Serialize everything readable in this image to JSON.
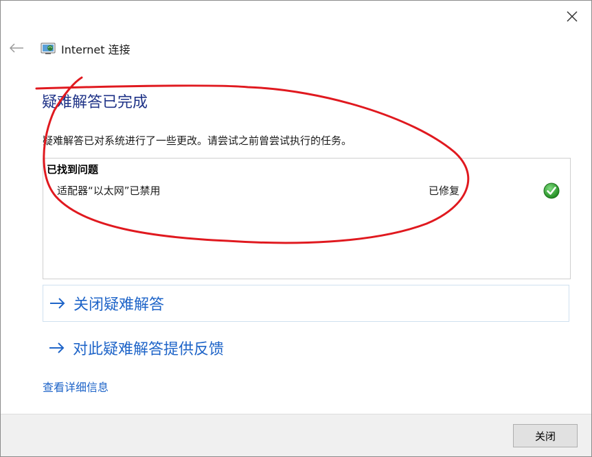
{
  "window": {
    "title": "Internet 连接"
  },
  "main": {
    "heading": "疑难解答已完成",
    "description": "疑难解答已对系统进行了一些更改。请尝试之前曾尝试执行的任务。",
    "results": {
      "header": "已找到问题",
      "problems": [
        {
          "name": "适配器“以太网”已禁用",
          "status": "已修复",
          "status_icon": "check-icon"
        }
      ]
    },
    "actions": [
      {
        "label": "关闭疑难解答",
        "icon": "arrow-right-icon"
      },
      {
        "label": "对此疑难解答提供反馈",
        "icon": "arrow-right-icon"
      }
    ],
    "details_link": "查看详细信息"
  },
  "footer": {
    "close_button": "关闭"
  },
  "colors": {
    "heading": "#1e3287",
    "link": "#1e64c8",
    "success": "#2e9e2e",
    "annotation": "#e0191f"
  }
}
